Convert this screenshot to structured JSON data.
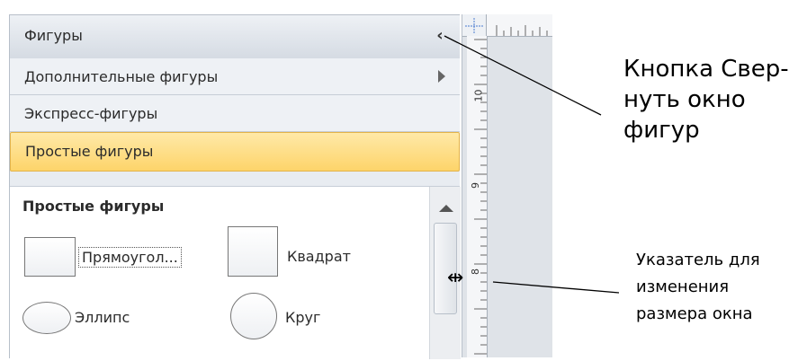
{
  "panel": {
    "header_title": "Фигуры",
    "collapse_glyph": "‹",
    "rows": {
      "more_shapes": "Дополнительные фигуры",
      "quick_shapes": "Экспресс-фигуры",
      "basic_shapes": "Простые фигуры"
    },
    "stencil": {
      "title": "Простые фигуры",
      "shapes": {
        "rectangle": "Прямоугол...",
        "square": "Квадрат",
        "ellipse": "Эллипс",
        "circle": "Круг"
      }
    }
  },
  "ruler": {
    "labels": [
      "10",
      "9",
      "8"
    ]
  },
  "callouts": {
    "collapse_line1": "Кнопка Свер-",
    "collapse_line2": "нуть окно",
    "collapse_line3": "фигур",
    "resize_line1": "Указатель для",
    "resize_line2": "изменения",
    "resize_line3": "размера окна"
  },
  "colors": {
    "selected_row": "#fdd46a",
    "panel_bg": "#e8ecf1"
  }
}
